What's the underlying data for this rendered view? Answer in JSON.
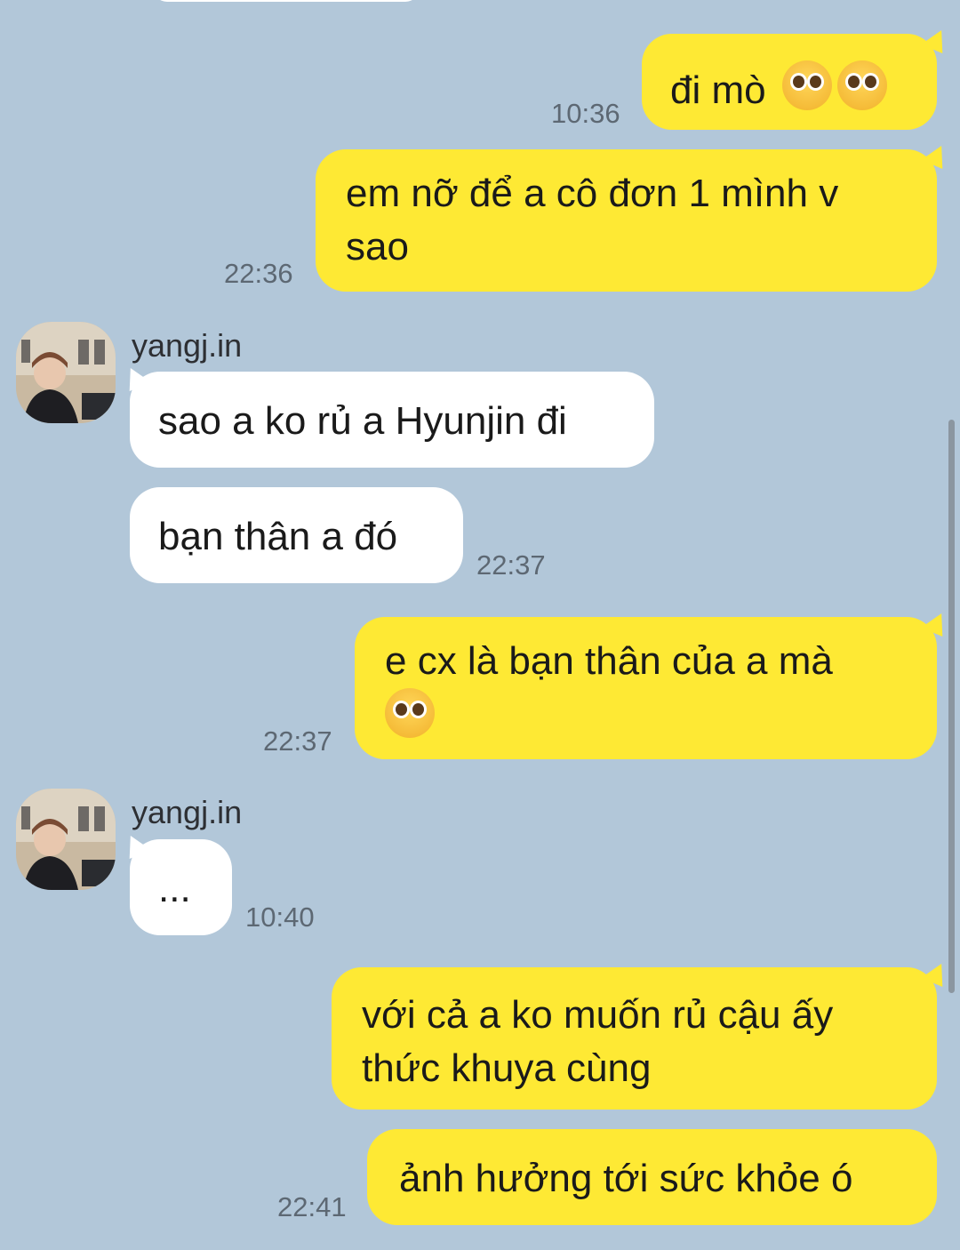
{
  "messages": [
    {
      "side": "mine",
      "text": "đi mò",
      "emoji": [
        "pleading-face-tears-icon",
        "pleading-face-tears-icon"
      ],
      "time": "10:36"
    },
    {
      "side": "mine",
      "text_lines": [
        "em nỡ để a cô đơn 1 mình v",
        "sao"
      ],
      "time": "22:36"
    },
    {
      "side": "theirs",
      "sender": "yangj.in",
      "text": "sao a ko rủ a Hyunjin đi"
    },
    {
      "side": "theirs",
      "text": "bạn thân a đó",
      "time": "22:37"
    },
    {
      "side": "mine",
      "text": "e cx là bạn thân của a mà",
      "emoji": [
        "pleading-face-icon"
      ],
      "time": "22:37"
    },
    {
      "side": "theirs",
      "sender": "yangj.in",
      "text": "...",
      "time": "10:40"
    },
    {
      "side": "mine",
      "text_lines": [
        "với cả a ko muốn rủ cậu ấy",
        "thức khuya cùng"
      ]
    },
    {
      "side": "mine",
      "text": "ảnh hưởng tới sức khỏe ó",
      "time": "22:41"
    }
  ],
  "colors": {
    "background": "#b2c7d9",
    "mine_bubble": "#fee934",
    "theirs_bubble": "#ffffff"
  }
}
